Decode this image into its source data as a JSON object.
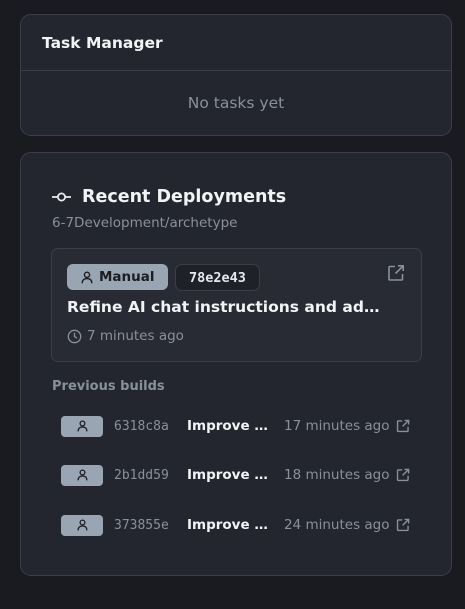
{
  "task_manager": {
    "title": "Task Manager",
    "empty_text": "No tasks yet"
  },
  "deployments": {
    "title": "Recent Deployments",
    "repo": "6-7Development/archetype",
    "latest": {
      "trigger_label": "Manual",
      "commit_hash": "78e2e43",
      "message": "Refine AI chat instructions and add t...",
      "time": "7 minutes ago"
    },
    "previous_label": "Previous builds",
    "previous": [
      {
        "hash": "6318c8a",
        "message": "Improve A...",
        "time": "17 minutes ago"
      },
      {
        "hash": "2b1dd59",
        "message": "Improve c...",
        "time": "18 minutes ago"
      },
      {
        "hash": "373855e",
        "message": "Improve M...",
        "time": "24 minutes ago"
      }
    ]
  },
  "icons": {
    "commit": "git-commit-icon",
    "person": "user-icon",
    "external": "external-link-icon",
    "clock": "clock-icon"
  },
  "colors": {
    "background": "#191b21",
    "card": "#23262e",
    "badge": "#9aa5b3",
    "muted_text": "#8a909b"
  }
}
